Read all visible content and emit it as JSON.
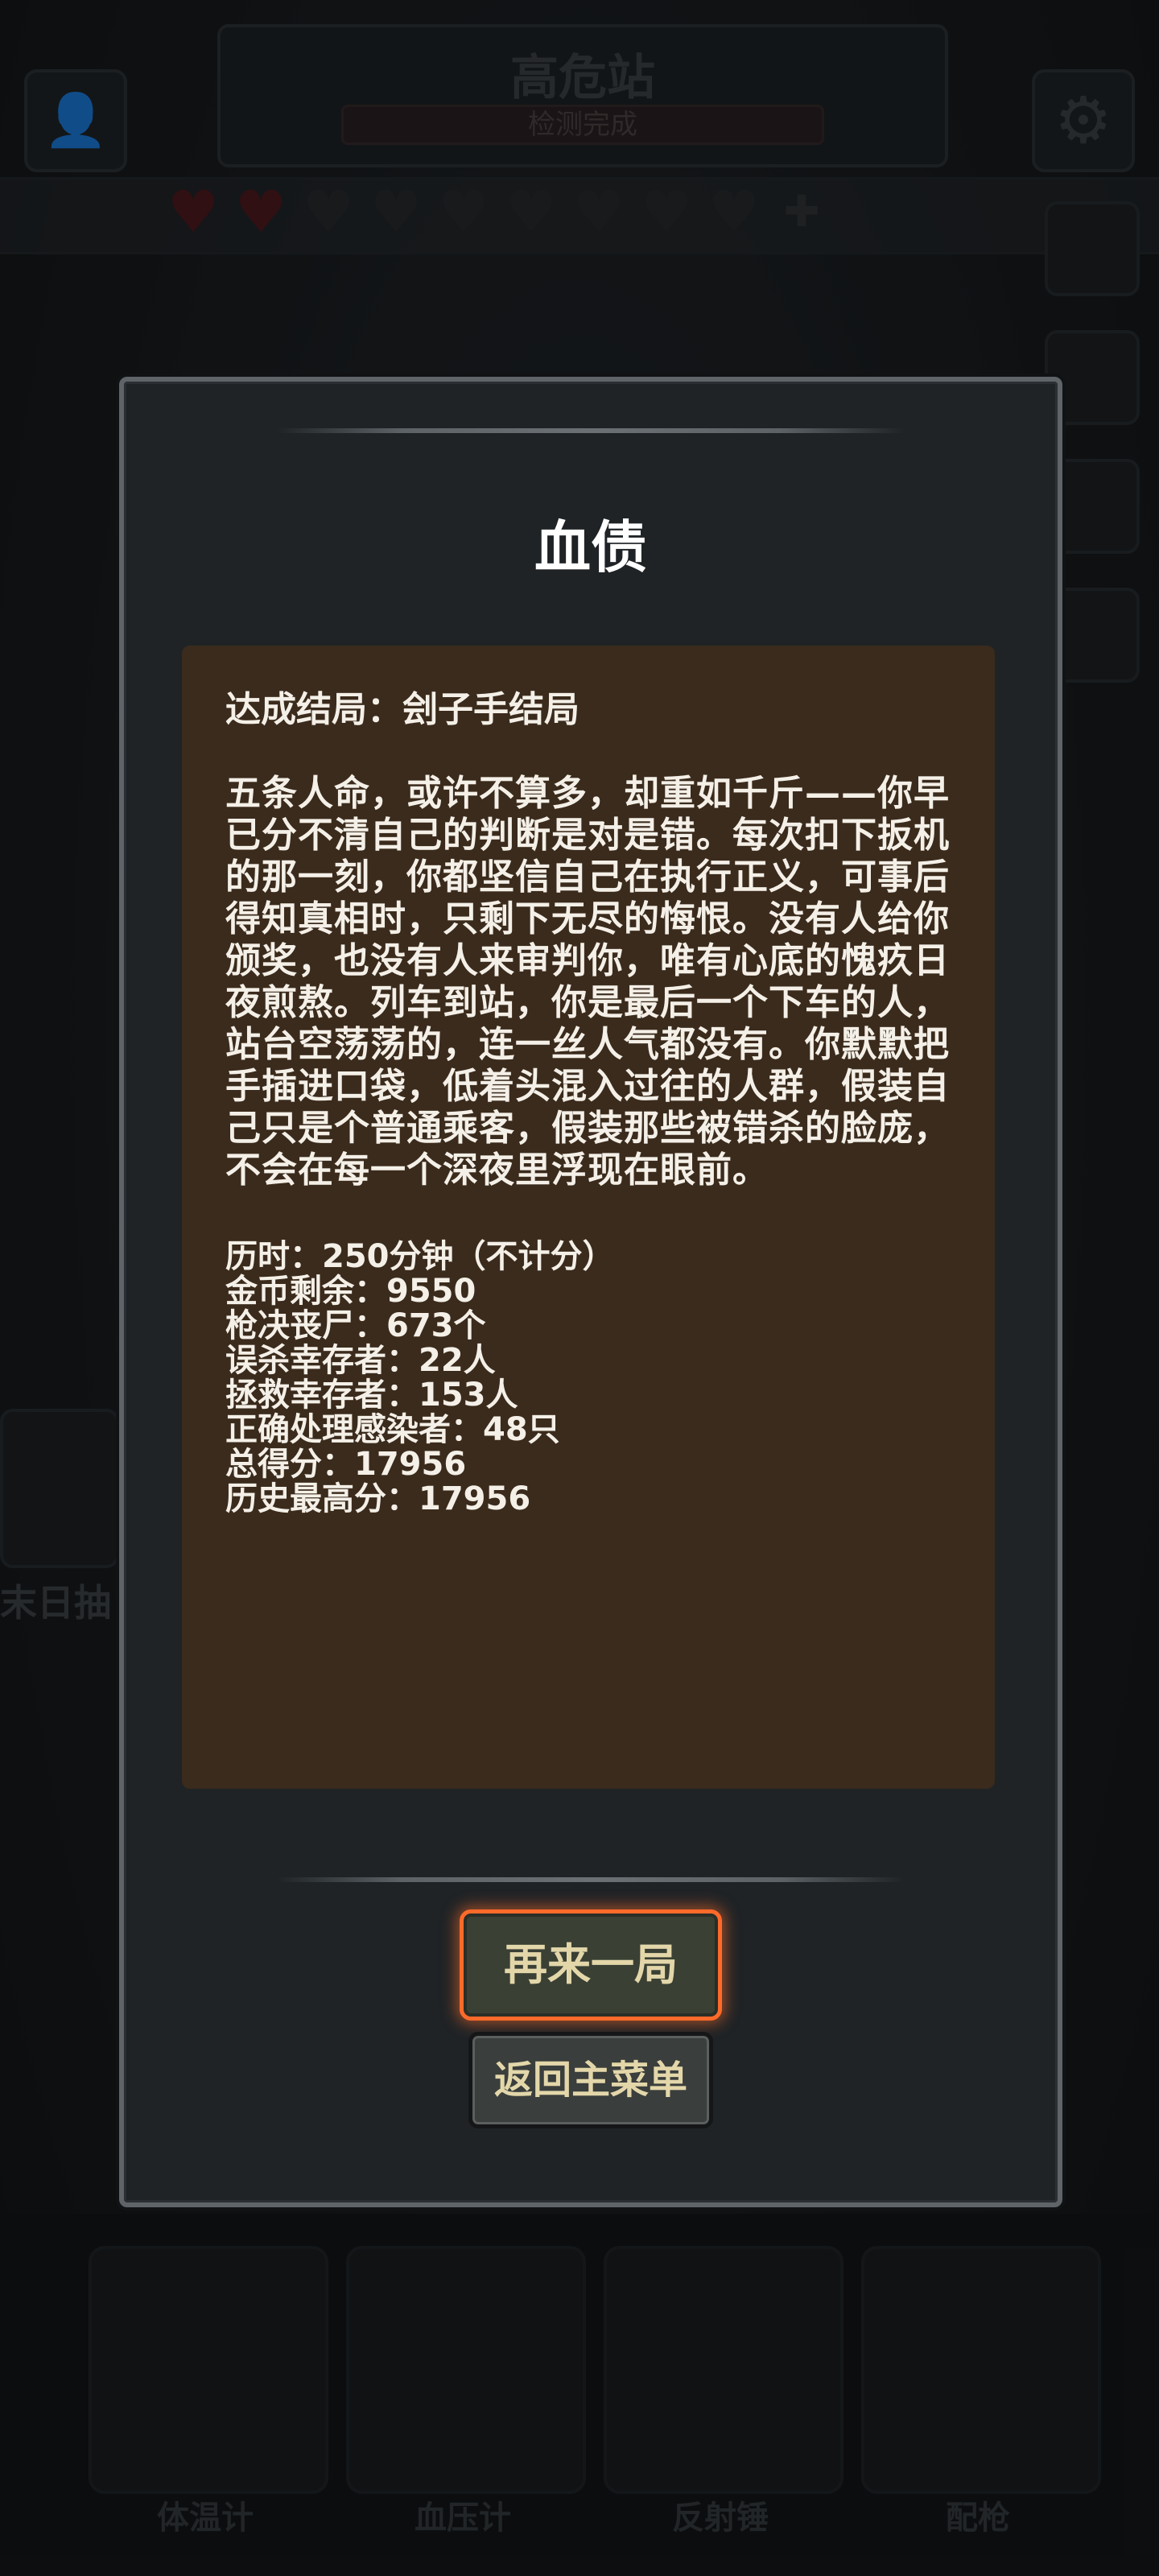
{
  "background": {
    "station_title": "高危站",
    "station_status": "检测完成",
    "hearts": [
      "red",
      "red",
      "dark",
      "dark",
      "dark",
      "dark",
      "dark",
      "dark",
      "dark",
      "plus"
    ],
    "wheel_label": "末日抽",
    "tools": [
      "体温计",
      "血压计",
      "反射锤",
      "配枪"
    ]
  },
  "modal": {
    "title": "血债",
    "ending": "达成结局：刽子手结局",
    "story": "五条人命，或许不算多，却重如千斤——你早已分不清自己的判断是对是错。每次扣下扳机的那一刻，你都坚信自己在执行正义，可事后得知真相时，只剩下无尽的悔恨。没有人给你颁奖，也没有人来审判你，唯有心底的愧疚日夜煎熬。列车到站，你是最后一个下车的人，站台空荡荡的，连一丝人气都没有。你默默把手插进口袋，低着头混入过往的人群，假装自己只是个普通乘客，假装那些被错杀的脸庞，不会在每一个深夜里浮现在眼前。",
    "stats": [
      "历时：250分钟（不计分）",
      "金币剩余：9550",
      "枪决丧尸：673个",
      "误杀幸存者：22人",
      "拯救幸存者：153人",
      "正确处理感染者：48只",
      "总得分：17956",
      "历史最高分：17956"
    ],
    "buttons": {
      "retry": "再来一局",
      "menu": "返回主菜单"
    }
  },
  "colors": {
    "panel_bg": "#3b2b1c",
    "modal_bg": "#1f2326",
    "primary_border": "#ff6a2a",
    "button_text": "#e3d7aa"
  }
}
